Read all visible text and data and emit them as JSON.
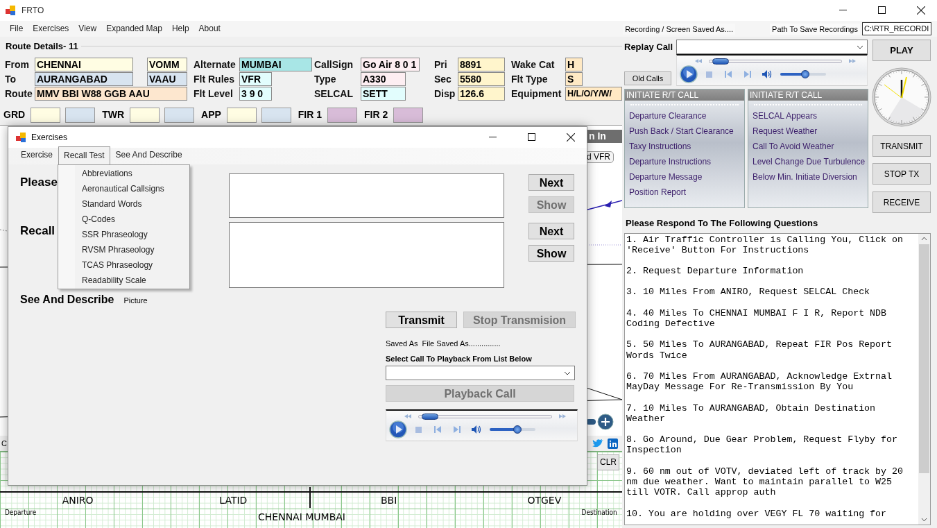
{
  "window": {
    "title": "FRTO"
  },
  "menu": [
    "File",
    "Exercises",
    "View",
    "Expanded Map",
    "Help",
    "About"
  ],
  "recording": {
    "saved_label": "Recording / Screen Saved As....",
    "path_label": "Path To Save Recordings",
    "path_value": "C:\\RTR_RECORDI"
  },
  "route_details": {
    "title": "Route Details- 11",
    "groups": [
      {
        "rows": [
          {
            "label": "From",
            "fields": [
              {
                "value": "CHENNAI",
                "color": "#fffde3"
              },
              {
                "value": "VOMM",
                "color": "#fffde3"
              }
            ]
          },
          {
            "label": "To",
            "fields": [
              {
                "value": "AURANGABAD",
                "color": "#d8e4f0"
              },
              {
                "value": "VAAU",
                "color": "#d8e4f0"
              }
            ]
          },
          {
            "label": "Route",
            "fields": [
              {
                "value": "MMV BBI W88 GGB AAU",
                "color": "#fde7cf"
              }
            ]
          }
        ]
      },
      {
        "rows": [
          {
            "label": "Alternate",
            "fields": [
              {
                "value": "MUMBAI",
                "color": "#a8e6e6"
              }
            ]
          },
          {
            "label": "Flt Rules",
            "fields": [
              {
                "value": "VFR",
                "color": "#e2fdfd"
              }
            ]
          },
          {
            "label": "Flt Level",
            "fields": [
              {
                "value": "3 9 0",
                "color": "#e2fdfd"
              }
            ]
          }
        ]
      },
      {
        "rows": [
          {
            "label": "CallSign",
            "fields": [
              {
                "value": "Go Air 8 0 1",
                "color": "#fdeef2"
              }
            ]
          },
          {
            "label": "Type",
            "fields": [
              {
                "value": "A330",
                "color": "#fdeef2"
              }
            ]
          },
          {
            "label": "SELCAL",
            "fields": [
              {
                "value": "SETT",
                "color": "#e2fdfd"
              }
            ]
          }
        ]
      },
      {
        "rows": [
          {
            "label": "Pri",
            "fields": [
              {
                "value": "8891",
                "color": "#fff5cc"
              }
            ]
          },
          {
            "label": "Sec",
            "fields": [
              {
                "value": "5580",
                "color": "#fff5cc"
              }
            ]
          },
          {
            "label": "Disp",
            "fields": [
              {
                "value": "126.6",
                "color": "#fff5cc"
              }
            ]
          }
        ]
      },
      {
        "rows": [
          {
            "label": "Wake Cat",
            "fields": [
              {
                "value": "H",
                "color": "#ffe9c4"
              }
            ]
          },
          {
            "label": "Flt Type",
            "fields": [
              {
                "value": "S",
                "color": "#ffe9c4"
              }
            ]
          },
          {
            "label": "Equipment",
            "fields": [
              {
                "value": "H/L/O/Y/W/",
                "color": "#ffe9c4"
              }
            ]
          }
        ]
      }
    ]
  },
  "frequencies": [
    {
      "label": "GRD",
      "boxes": [
        {
          "color": "#fffde3"
        },
        {
          "color": "#d8e4f0"
        }
      ]
    },
    {
      "label": "TWR",
      "boxes": [
        {
          "color": "#fffde3"
        },
        {
          "color": "#d8e4f0"
        }
      ]
    },
    {
      "label": "APP",
      "boxes": [
        {
          "color": "#fffde3"
        },
        {
          "color": "#d8e4f0"
        }
      ]
    },
    {
      "label": "FIR 1",
      "boxes": [
        {
          "color": "#d8bcd8"
        }
      ]
    },
    {
      "label": "FIR 2",
      "boxes": [
        {
          "color": "#d8bcd8"
        }
      ]
    }
  ],
  "map": {
    "header": "n In",
    "vfr_button": "d VFR",
    "corner_label": "C",
    "clear_button": "CLR"
  },
  "strip": {
    "fixes": [
      "ANIRO",
      "LATID",
      "BBI",
      "OTGEV"
    ],
    "departure": "Departure",
    "fir": "CHENNAI MUMBAI",
    "destination": "Destination"
  },
  "replay": {
    "label": "Replay Call",
    "old_calls": "Old Calls",
    "player": {
      "seek": {
        "level": 0.03
      },
      "volume": {
        "level": 0.55
      }
    }
  },
  "play_button": "PLAY",
  "tx_buttons": [
    "TRANSMIT",
    "STOP TX",
    "RECEIVE"
  ],
  "rt_panels": [
    {
      "title": "INITIATE R/T CALL",
      "items": [
        "Departure Clearance",
        "Push Back / Start Clearance",
        "Taxy Instructions",
        "Departure Instructions",
        "Departure Message",
        "Position Report"
      ]
    },
    {
      "title": "INITIATE R/T CALL",
      "items": [
        "SELCAL Appears",
        "Request Weather",
        "Call To Avoid Weather",
        "Level Change Due Turbulence",
        "Below Min. Initiate Diversion"
      ]
    }
  ],
  "questions": {
    "title": "Please Respond To The Following Questions",
    "items": [
      "1. Air Traffic Controller is Calling You, Click on 'Receive' Button For Instructions",
      "2. Request Departure Information",
      "3. 10 Miles From ANIRO, Request SELCAL Check",
      "4. 40 Miles To CHENNAI MUMBAI F I R, Report NDB Coding Defective",
      "5. 50 Miles To AURANGABAD, Repeat FIR Pos Report Words Twice",
      "6. 70 Miles From AURANGABAD, Acknowledge Extrnal MayDay Message For Re-Transmission By You",
      "7. 10 Miles To AURANGABAD, Obtain Destination Weather",
      "8. Go Around, Due Gear Problem, Request Flyby for Inspection",
      "9. 60 nm out of VOTV, deviated left of track by 20 nm due weather. Want to maintain parallel to W25 till VOTR. Call approp auth",
      "10. You are holding over VEGY FL 70 waiting for"
    ]
  },
  "dialog": {
    "title": "Exercises",
    "tabs": [
      {
        "label": "Exercise",
        "selected": false
      },
      {
        "label": "Recall Test",
        "selected": true
      },
      {
        "label": "See And Describe",
        "selected": false
      }
    ],
    "menu_items": [
      "Abbreviations",
      "Aeronautical Callsigns",
      "Standard Words",
      "Q-Codes",
      "SSR Phraseology",
      "RVSM Phraseology",
      "TCAS Phraseology",
      "Readability Scale"
    ],
    "answer_rows": [
      {
        "label": "Please",
        "buttons": [
          {
            "label": "Next",
            "disabled": false
          },
          {
            "label": "Show",
            "disabled": true
          }
        ]
      },
      {
        "label": "Recall",
        "buttons": [
          {
            "label": "Next",
            "disabled": false
          },
          {
            "label": "Show",
            "disabled": false
          }
        ]
      }
    ],
    "see_describe": {
      "label": "See And Describe",
      "note": "Picture"
    },
    "tx_buttons": [
      {
        "label": "Transmit",
        "disabled": false
      },
      {
        "label": "Stop Transmision",
        "disabled": true
      }
    ],
    "saved_label": "Saved As",
    "saved_value": "File Saved As...............",
    "select_label": "Select Call To Playback From List Below",
    "playback": {
      "label": "Playback Call",
      "disabled": true
    },
    "player": {
      "seek": {
        "level": 0.03
      },
      "volume": {
        "level": 0.6
      }
    }
  }
}
